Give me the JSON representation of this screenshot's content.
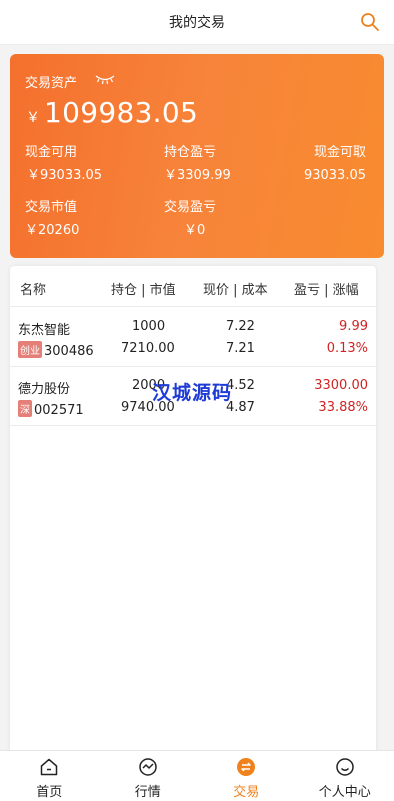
{
  "header": {
    "title": "我的交易"
  },
  "asset": {
    "label": "交易资产",
    "currency": "￥",
    "total": "109983.05",
    "stats": [
      {
        "label": "现金可用",
        "value": "￥93033.05"
      },
      {
        "label": "持仓盈亏",
        "value": "￥3309.99"
      },
      {
        "label": "现金可取",
        "value": "93033.05"
      },
      {
        "label": "交易市值",
        "value": "￥20260"
      },
      {
        "label": "交易盈亏",
        "value": "￥0"
      }
    ]
  },
  "table": {
    "headers": [
      "名称",
      "持仓 | 市值",
      "现价 | 成本",
      "盈亏 | 涨幅"
    ],
    "rows": [
      {
        "name": "东杰智能",
        "tag": "创业",
        "code": "300486",
        "position": "1000",
        "value": "7210.00",
        "price": "7.22",
        "cost": "7.21",
        "pnl": "9.99",
        "pct": "0.13%"
      },
      {
        "name": "德力股份",
        "tag": "深",
        "code": "002571",
        "position": "2000",
        "value": "9740.00",
        "price": "4.52",
        "cost": "4.87",
        "pnl": "3300.00",
        "pct": "33.88%"
      }
    ]
  },
  "watermark": "汉城源码",
  "tabs": [
    {
      "label": "首页",
      "icon": "home-icon"
    },
    {
      "label": "行情",
      "icon": "market-icon"
    },
    {
      "label": "交易",
      "icon": "trade-icon",
      "active": true
    },
    {
      "label": "个人中心",
      "icon": "profile-icon"
    }
  ],
  "colors": {
    "accent": "#f0821e",
    "card_start": "#f4702d",
    "card_end": "#f98b2f",
    "loss_gain": "#d02424",
    "tag": "#e58079",
    "watermark": "#1f3bd6"
  }
}
